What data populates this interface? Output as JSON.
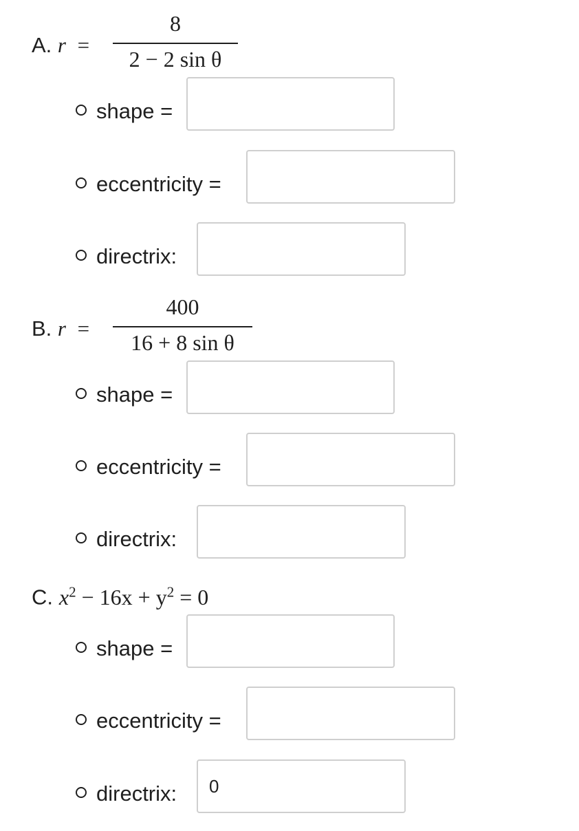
{
  "problems": [
    {
      "letter": "A.",
      "lhs": "r",
      "eq": "=",
      "numerator": "8",
      "denominator": "2 − 2 sin θ",
      "fields": [
        {
          "label": "shape =",
          "value": ""
        },
        {
          "label": "eccentricity =",
          "value": ""
        },
        {
          "label": "directrix:",
          "value": ""
        }
      ]
    },
    {
      "letter": "B.",
      "lhs": "r",
      "eq": "=",
      "numerator": "400",
      "denominator": "16 + 8 sin θ",
      "fields": [
        {
          "label": "shape =",
          "value": ""
        },
        {
          "label": "eccentricity =",
          "value": ""
        },
        {
          "label": "directrix:",
          "value": ""
        }
      ]
    },
    {
      "letter": "C.",
      "equation_parts": [
        "x",
        "2",
        " − 16x + y",
        "2",
        " = 0"
      ],
      "fields": [
        {
          "label": "shape =",
          "value": ""
        },
        {
          "label": "eccentricity =",
          "value": ""
        },
        {
          "label": "directrix:",
          "value": "0"
        }
      ]
    }
  ]
}
